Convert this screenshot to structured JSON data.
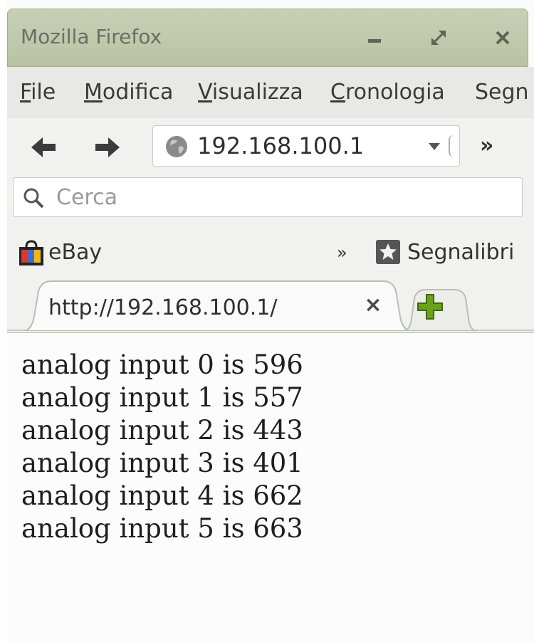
{
  "window": {
    "title": "Mozilla Firefox"
  },
  "menu": {
    "items": [
      {
        "label": "File",
        "accel": "F",
        "rest": "ile"
      },
      {
        "label": "Modifica",
        "accel": "M",
        "rest": "odifica"
      },
      {
        "label": "Visualizza",
        "accel": "V",
        "rest": "isualizza"
      },
      {
        "label": "Cronologia",
        "accel": "C",
        "rest": "ronologia"
      },
      {
        "label": "Segn",
        "accel": "",
        "rest": "Segn"
      }
    ]
  },
  "nav": {
    "url": "192.168.100.1",
    "overflow": "»"
  },
  "search": {
    "placeholder": "Cerca"
  },
  "bookmarks": {
    "items": [
      {
        "label": "eBay"
      }
    ],
    "overflow": "»",
    "menu_label": "Segnalibri"
  },
  "tabs": [
    {
      "title": "http://192.168.100.1/",
      "close": "×"
    }
  ],
  "page": {
    "lines": [
      "analog input 0 is 596",
      "analog input 1 is 557",
      "analog input 2 is 443",
      "analog input 3 is 401",
      "analog input 4 is 662",
      "analog input 5 is 663"
    ]
  }
}
